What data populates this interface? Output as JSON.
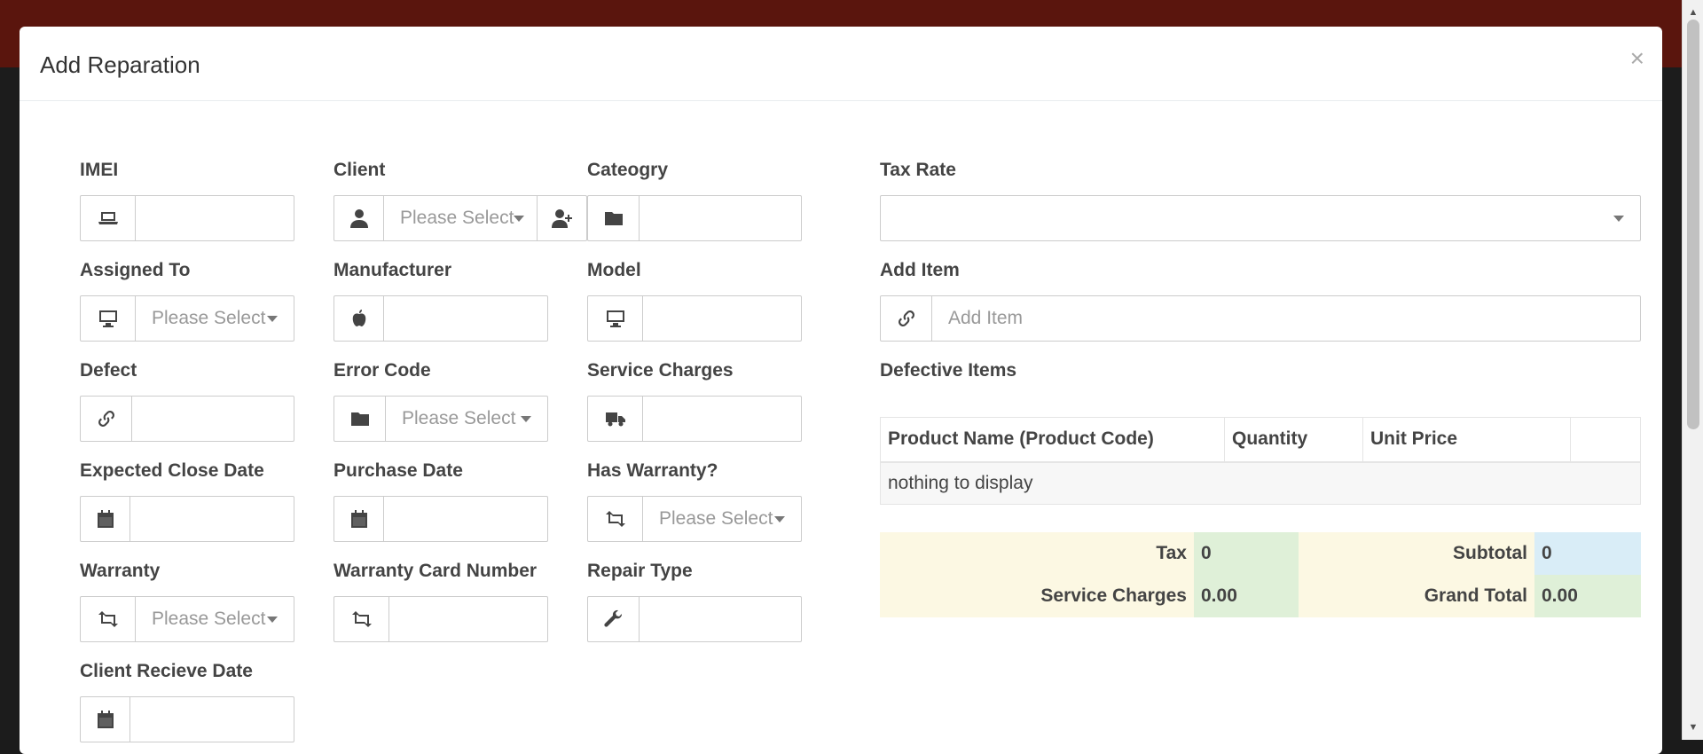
{
  "modal": {
    "title": "Add Reparation",
    "close_symbol": "×"
  },
  "fields": {
    "imei": {
      "label": "IMEI",
      "value": ""
    },
    "client": {
      "label": "Client",
      "value": "Please Select"
    },
    "category": {
      "label": "Cateogry",
      "value": ""
    },
    "assigned_to": {
      "label": "Assigned To",
      "value": "Please Select"
    },
    "manufacturer": {
      "label": "Manufacturer",
      "value": ""
    },
    "model": {
      "label": "Model",
      "value": ""
    },
    "defect": {
      "label": "Defect",
      "value": ""
    },
    "error_code": {
      "label": "Error Code",
      "value": "Please Select"
    },
    "service_charges": {
      "label": "Service Charges",
      "value": ""
    },
    "expected_close_date": {
      "label": "Expected Close Date",
      "value": ""
    },
    "purchase_date": {
      "label": "Purchase Date",
      "value": ""
    },
    "has_warranty": {
      "label": "Has Warranty?",
      "value": "Please Select"
    },
    "warranty": {
      "label": "Warranty",
      "value": "Please Select"
    },
    "warranty_card_number": {
      "label": "Warranty Card Number",
      "value": ""
    },
    "repair_type": {
      "label": "Repair Type",
      "value": ""
    },
    "client_receive_date": {
      "label": "Client Recieve Date",
      "value": ""
    }
  },
  "tax_rate": {
    "label": "Tax Rate",
    "value": ""
  },
  "add_item": {
    "label": "Add Item",
    "placeholder": "Add Item"
  },
  "defective_items": {
    "label": "Defective Items",
    "columns": [
      "Product Name (Product Code)",
      "Quantity",
      "Unit Price",
      ""
    ],
    "empty_text": "nothing to display"
  },
  "totals": {
    "tax_label": "Tax",
    "tax_value": "0",
    "subtotal_label": "Subtotal",
    "subtotal_value": "0",
    "service_charges_label": "Service Charges",
    "service_charges_value": "0.00",
    "grand_total_label": "Grand Total",
    "grand_total_value": "0.00"
  },
  "colors": {
    "topbar": "#5a150d",
    "warning_bg": "#fcf8e3",
    "success_bg": "#dff0d8",
    "info_bg": "#d9edf7"
  }
}
